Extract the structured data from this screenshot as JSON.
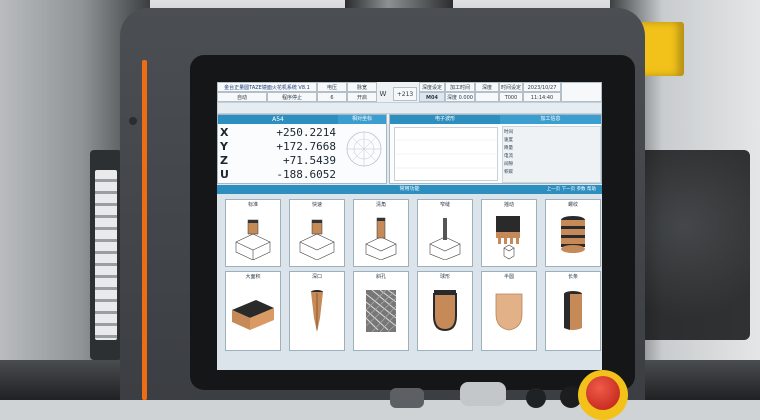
{
  "colors": {
    "accent_blue": "#2d8fc0",
    "housing": "#3b3e42",
    "accent_orange": "#ec6d14",
    "estop_red": "#d72a1f",
    "estop_yellow": "#f2c21b",
    "copper": "#c58a57"
  },
  "header": {
    "title": "金台正量圆TAZE镜面火花机系统 V8.1",
    "mode_label": "自动",
    "status": "程序停止",
    "row1": [
      "电压",
      "脉宽",
      "",
      "",
      "深度设定",
      "加工时间",
      "深度",
      "时间设定",
      ""
    ],
    "row2": [
      "6",
      "开启",
      "",
      "",
      "M04",
      "0.000",
      "",
      "T000",
      ""
    ],
    "axis_label": "W",
    "axis_value": "+213",
    "depth_label": "深度 0.000",
    "date": "2023/10/27",
    "time": "11:14:40"
  },
  "coords": {
    "panel_title": "A54",
    "panel_title2": "相对坐标",
    "axes": [
      {
        "axis": "X",
        "value": "+250.2214"
      },
      {
        "axis": "Y",
        "value": "+172.7668"
      },
      {
        "axis": "Z",
        "value": "+71.5439"
      },
      {
        "axis": "U",
        "value": "-188.6052"
      }
    ]
  },
  "status_panel": {
    "title_left": "电子波形",
    "title_right": "加工信息",
    "items": [
      "时间",
      "速度",
      "降量",
      "电流",
      "间隙",
      "积碳"
    ]
  },
  "functions": {
    "title": "常用功能",
    "nav_prev": "上一页",
    "nav_next": "下一页",
    "nav_tab1": "参数",
    "nav_tab2": "帮助",
    "tiles": [
      {
        "label": "标准",
        "icon": "cube-electrode-icon"
      },
      {
        "label": "快速",
        "icon": "cube-electrode-icon"
      },
      {
        "label": "清角",
        "icon": "corner-electrode-icon"
      },
      {
        "label": "窄缝",
        "icon": "slot-electrode-icon"
      },
      {
        "label": "摇动",
        "icon": "comb-electrode-icon"
      },
      {
        "label": "螺纹",
        "icon": "thread-electrode-icon"
      },
      {
        "label": "大面积",
        "icon": "plate-electrode-icon"
      },
      {
        "label": "深口",
        "icon": "needle-electrode-icon"
      },
      {
        "label": "斜孔",
        "icon": "mesh-electrode-icon"
      },
      {
        "label": "球形",
        "icon": "capsule-electrode-icon"
      },
      {
        "label": "半圆",
        "icon": "shield-electrode-icon"
      },
      {
        "label": "长条",
        "icon": "cylinder-electrode-icon"
      }
    ]
  }
}
